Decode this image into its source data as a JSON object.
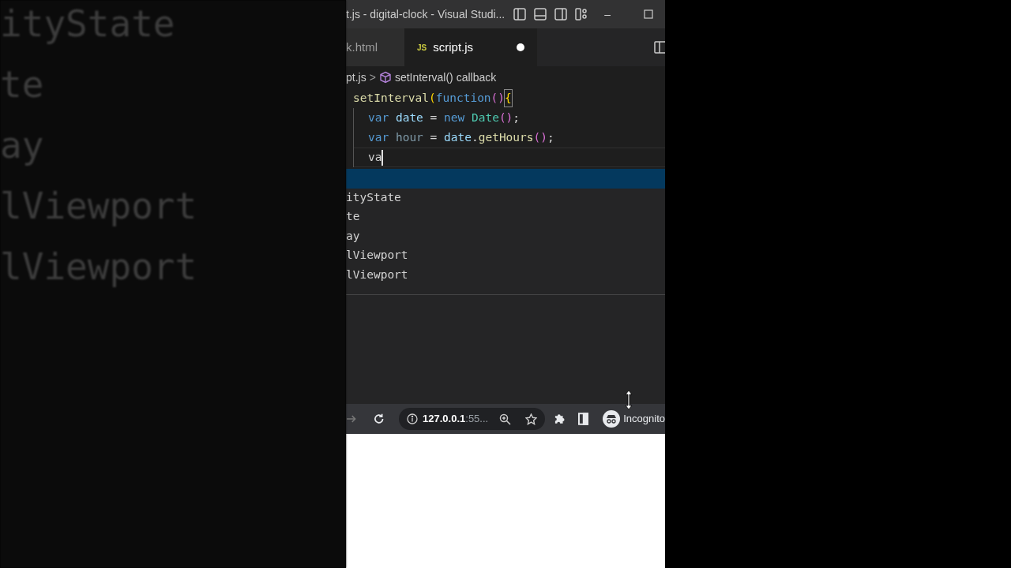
{
  "backdrop": {
    "lines": [
      "ityState",
      "te",
      "ay",
      "lViewport",
      "lViewport"
    ]
  },
  "window": {
    "title": "t.js - digital-clock - Visual Studi...",
    "minimize": "–"
  },
  "tabs": [
    {
      "label": "k.html",
      "selected": false,
      "dirty": false
    },
    {
      "label": "script.js",
      "selected": true,
      "dirty": true,
      "badge": "JS"
    }
  ],
  "breadcrumb": {
    "file": "pt.js",
    "separator": ">",
    "symbol": "setInterval() callback"
  },
  "code": [
    {
      "indent": false,
      "cursor": false,
      "tokens": [
        {
          "kind": "func",
          "text": "setInterval"
        },
        {
          "kind": "paren",
          "text": "("
        },
        {
          "kind": "keyword",
          "text": "function"
        },
        {
          "kind": "bracket",
          "text": "()"
        },
        {
          "kind": "match",
          "text": "{"
        }
      ]
    },
    {
      "indent": true,
      "cursor": false,
      "tokens": [
        {
          "kind": "keyword",
          "text": "var "
        },
        {
          "kind": "var",
          "text": "date"
        },
        {
          "kind": "plain",
          "text": " = "
        },
        {
          "kind": "keyword",
          "text": "new "
        },
        {
          "kind": "class",
          "text": "Date"
        },
        {
          "kind": "bracket",
          "text": "()"
        },
        {
          "kind": "plain",
          "text": ";"
        }
      ]
    },
    {
      "indent": true,
      "cursor": false,
      "tokens": [
        {
          "kind": "keyword",
          "text": "var "
        },
        {
          "kind": "dim",
          "text": "hour"
        },
        {
          "kind": "plain",
          "text": " = "
        },
        {
          "kind": "var",
          "text": "date"
        },
        {
          "kind": "plain",
          "text": "."
        },
        {
          "kind": "func",
          "text": "getHours"
        },
        {
          "kind": "bracket",
          "text": "()"
        },
        {
          "kind": "plain",
          "text": ";"
        }
      ]
    },
    {
      "indent": true,
      "cursor": true,
      "tokens": [
        {
          "kind": "plain",
          "text": "va"
        }
      ]
    }
  ],
  "suggestions": [
    {
      "selected": true
    },
    {
      "label": "ityState",
      "selected": false
    },
    {
      "label": "te",
      "selected": false
    },
    {
      "label": "ay",
      "selected": false
    },
    {
      "label": "lViewport",
      "selected": false
    },
    {
      "label": "lViewport",
      "selected": false
    }
  ],
  "browser": {
    "url_host": "127.0.0.1",
    "url_rest": ":55...",
    "profile": "Incognito"
  }
}
